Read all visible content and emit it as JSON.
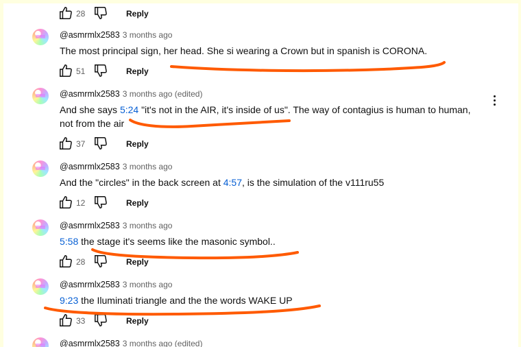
{
  "colors": {
    "page_bg": "#ffffe0",
    "link": "#065fd4",
    "annotation": "#ff5a00"
  },
  "icons": {
    "like": "thumbs-up-icon",
    "dislike": "thumbs-down-icon",
    "menu": "more-vert-icon"
  },
  "top_actions": {
    "likes": "28",
    "reply": "Reply"
  },
  "comments": [
    {
      "author": "@asmrmlx2583",
      "time": "3 months ago",
      "pre": "",
      "timestamp": "",
      "text": "The most principal sign, her head. She si wearing a Crown but in spanish is CORONA.",
      "likes": "51",
      "reply": "Reply"
    },
    {
      "author": "@asmrmlx2583",
      "time": "3 months ago (edited)",
      "pre": "And she says ",
      "timestamp": "5:24",
      "text": " \"it's not in the AIR, it's inside of us\". The way of contagius is human to human, not from the air",
      "likes": "37",
      "reply": "Reply"
    },
    {
      "author": "@asmrmlx2583",
      "time": "3 months ago",
      "pre": "And the \"circles\" in the back screen at ",
      "timestamp": "4:57",
      "text": ", is the simulation of the v111ru55",
      "likes": "12",
      "reply": "Reply"
    },
    {
      "author": "@asmrmlx2583",
      "time": "3 months ago",
      "pre": "",
      "timestamp": "5:58",
      "text": " the stage it's seems like the masonic symbol..",
      "likes": "28",
      "reply": "Reply"
    },
    {
      "author": "@asmrmlx2583",
      "time": "3 months ago",
      "pre": "",
      "timestamp": "9:23",
      "text": " the Iluminati triangle and the the words WAKE UP",
      "likes": "33",
      "reply": "Reply"
    },
    {
      "author": "@asmrmlx2583",
      "time": "3 months ago (edited)"
    }
  ]
}
